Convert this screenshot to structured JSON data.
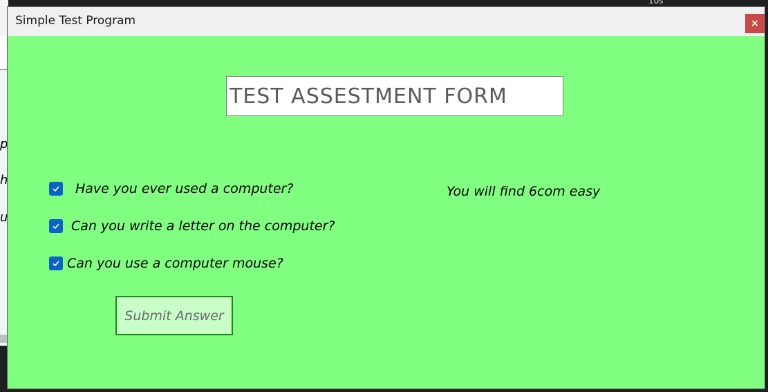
{
  "window": {
    "title": "Simple Test Program",
    "close_glyph": "×"
  },
  "form": {
    "title": "TEST ASSESTMENT FORM"
  },
  "questions": [
    {
      "label": "Have you ever used a computer?",
      "checked": true
    },
    {
      "label": "Can you write a letter on the computer?",
      "checked": true
    },
    {
      "label": "Can you use a computer mouse?",
      "checked": true
    }
  ],
  "result": {
    "text": "You will find 6com easy"
  },
  "submit": {
    "label": "Submit Answer"
  },
  "background": {
    "top_text": "10s",
    "left_chars": [
      "p",
      "h",
      "u"
    ]
  },
  "colors": {
    "window_bg": "#80ff80",
    "checkbox": "#0b63c7",
    "close_button": "#c64a4a",
    "submit_bg": "#c8ffc8",
    "submit_border": "#1a8a1a"
  },
  "icons": {
    "check": "check-icon",
    "close": "close-icon"
  }
}
